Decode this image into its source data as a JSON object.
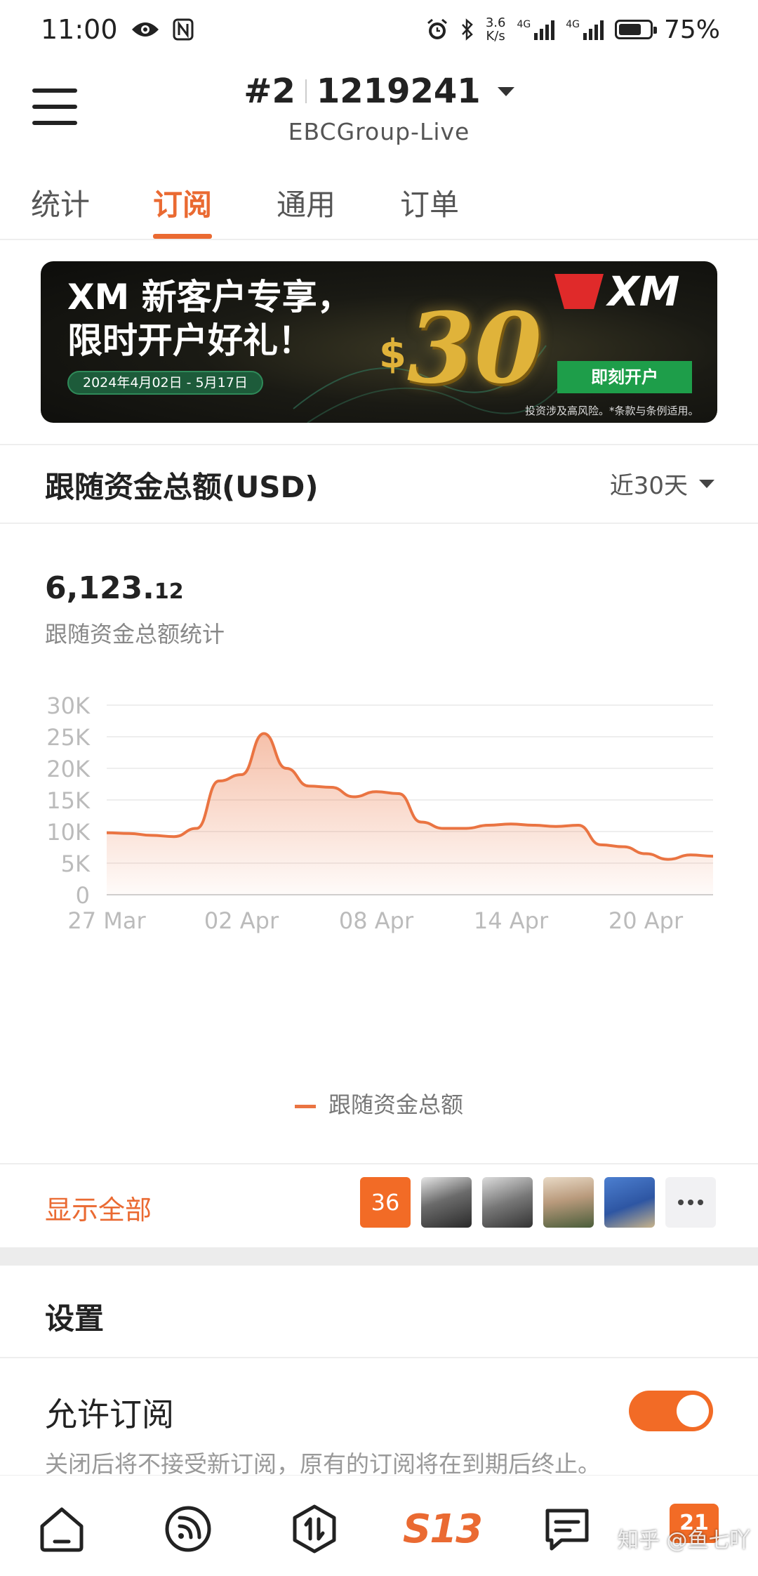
{
  "status_bar": {
    "time": "11:00",
    "speed_value": "3.6",
    "speed_unit": "K/s",
    "net1": "4G",
    "net2": "4G",
    "battery": "75%",
    "battery_level": 0.75
  },
  "header": {
    "account_index": "#2",
    "account_number": "1219241",
    "server": "EBCGroup-Live"
  },
  "tabs": [
    {
      "label": "统计",
      "active": false
    },
    {
      "label": "订阅",
      "active": true
    },
    {
      "label": "通用",
      "active": false
    },
    {
      "label": "订单",
      "active": false
    }
  ],
  "banner": {
    "title_line1": "XM 新客户专享，",
    "title_line2": "限时开户好礼！",
    "date_range": "2024年4月02日 - 5月17日",
    "dollar": "$",
    "amount": "30",
    "logo_text": "XM",
    "cta": "即刻开户",
    "note": "投资涉及高风险。*条款与条例适用。"
  },
  "card": {
    "title": "跟随资金总额(USD)",
    "period": "近30天",
    "amount_int": "6,123.",
    "amount_dec": "12",
    "amount_label": "跟随资金总额统计"
  },
  "chart_data": {
    "type": "area",
    "series": [
      {
        "name": "跟随资金总额",
        "color": "#ea7442",
        "values": [
          9800,
          9700,
          9400,
          9200,
          10500,
          18000,
          19000,
          25500,
          20000,
          17200,
          17000,
          15500,
          16300,
          16000,
          11500,
          10500,
          10500,
          11000,
          11200,
          11000,
          10800,
          11000,
          7900,
          7600,
          6500,
          5600,
          6300,
          6100
        ]
      }
    ],
    "x": [
      "27 Mar",
      "28 Mar",
      "29 Mar",
      "30 Mar",
      "31 Mar",
      "01 Apr",
      "02 Apr",
      "03 Apr",
      "04 Apr",
      "05 Apr",
      "06 Apr",
      "07 Apr",
      "08 Apr",
      "09 Apr",
      "10 Apr",
      "11 Apr",
      "12 Apr",
      "13 Apr",
      "14 Apr",
      "15 Apr",
      "16 Apr",
      "17 Apr",
      "18 Apr",
      "19 Apr",
      "20 Apr",
      "21 Apr",
      "22 Apr",
      "23 Apr"
    ],
    "x_tick_labels": [
      "27 Mar",
      "02 Apr",
      "08 Apr",
      "14 Apr",
      "20 Apr"
    ],
    "y_tick_labels": [
      "0",
      "5K",
      "10K",
      "15K",
      "20K",
      "25K",
      "30K"
    ],
    "ylim": [
      0,
      30000
    ],
    "grid": true,
    "legend_position": "bottom-center"
  },
  "subscribers": {
    "show_all": "显示全部",
    "count": "36"
  },
  "settings": {
    "title": "设置",
    "allow_label": "允许订阅",
    "allow_desc": "关闭后将不接受新订阅，原有的订阅将在到期后终止。",
    "allow_enabled": true
  },
  "bottom_nav": {
    "logo_text": "S13",
    "badge": "21",
    "watermark": "知乎 @鱼七吖",
    "items": [
      {
        "icon": "home-icon"
      },
      {
        "icon": "signal-feed-icon"
      },
      {
        "icon": "trade-icon"
      },
      {
        "icon": "brand-logo"
      },
      {
        "icon": "message-icon"
      },
      {
        "icon": "profile-badge"
      }
    ]
  }
}
